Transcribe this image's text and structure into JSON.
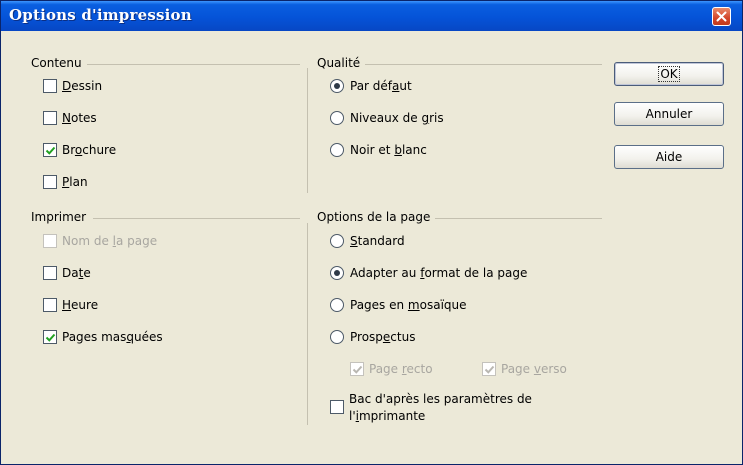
{
  "window": {
    "title": "Options d'impression"
  },
  "contenu": {
    "title": "Contenu",
    "items": [
      {
        "pre": "",
        "acc": "D",
        "post": "essin",
        "checked": false,
        "disabled": false
      },
      {
        "pre": "",
        "acc": "N",
        "post": "otes",
        "checked": false,
        "disabled": false
      },
      {
        "pre": "Br",
        "acc": "o",
        "post": "chure",
        "checked": true,
        "disabled": false
      },
      {
        "pre": "",
        "acc": "P",
        "post": "lan",
        "checked": false,
        "disabled": false
      }
    ]
  },
  "imprimer": {
    "title": "Imprimer",
    "items": [
      {
        "pre": "Nom de ",
        "acc": "l",
        "post": "a page",
        "checked": false,
        "disabled": true
      },
      {
        "pre": "Da",
        "acc": "t",
        "post": "e",
        "checked": false,
        "disabled": false
      },
      {
        "pre": "",
        "acc": "H",
        "post": "eure",
        "checked": false,
        "disabled": false
      },
      {
        "pre": "Pages mas",
        "acc": "q",
        "post": "uées",
        "checked": true,
        "disabled": false
      }
    ]
  },
  "qualite": {
    "title": "Qualité",
    "items": [
      {
        "pre": "Par déf",
        "acc": "a",
        "post": "ut",
        "selected": true
      },
      {
        "pre": "Niveaux de ",
        "acc": "g",
        "post": "ris",
        "selected": false
      },
      {
        "pre": "Noir et ",
        "acc": "b",
        "post": "lanc",
        "selected": false
      }
    ]
  },
  "options_page": {
    "title": "Options de la page",
    "items": [
      {
        "pre": "",
        "acc": "S",
        "post": "tandard",
        "selected": false
      },
      {
        "pre": "Adapter au ",
        "acc": "f",
        "post": "ormat de la page",
        "selected": true
      },
      {
        "pre": "Pages en ",
        "acc": "m",
        "post": "osaïque",
        "selected": false
      },
      {
        "pre": "Prosp",
        "acc": "e",
        "post": "ctus",
        "selected": false
      }
    ],
    "recto": {
      "pre": "Page ",
      "acc": "r",
      "post": "ecto",
      "checked": true,
      "disabled": true
    },
    "verso": {
      "pre": "Page ",
      "acc": "v",
      "post": "erso",
      "checked": true,
      "disabled": true
    },
    "bac": {
      "pre": "Bac d'après les paramètres de l'",
      "acc": "i",
      "post": "mprimante",
      "checked": false
    }
  },
  "buttons": {
    "ok": "OK",
    "annuler": "Annuler",
    "aide": "Aide"
  },
  "colors": {
    "title_bar": "#0553d8",
    "dialog_bg": "#ece9d8",
    "close_button": "#d2452a"
  }
}
